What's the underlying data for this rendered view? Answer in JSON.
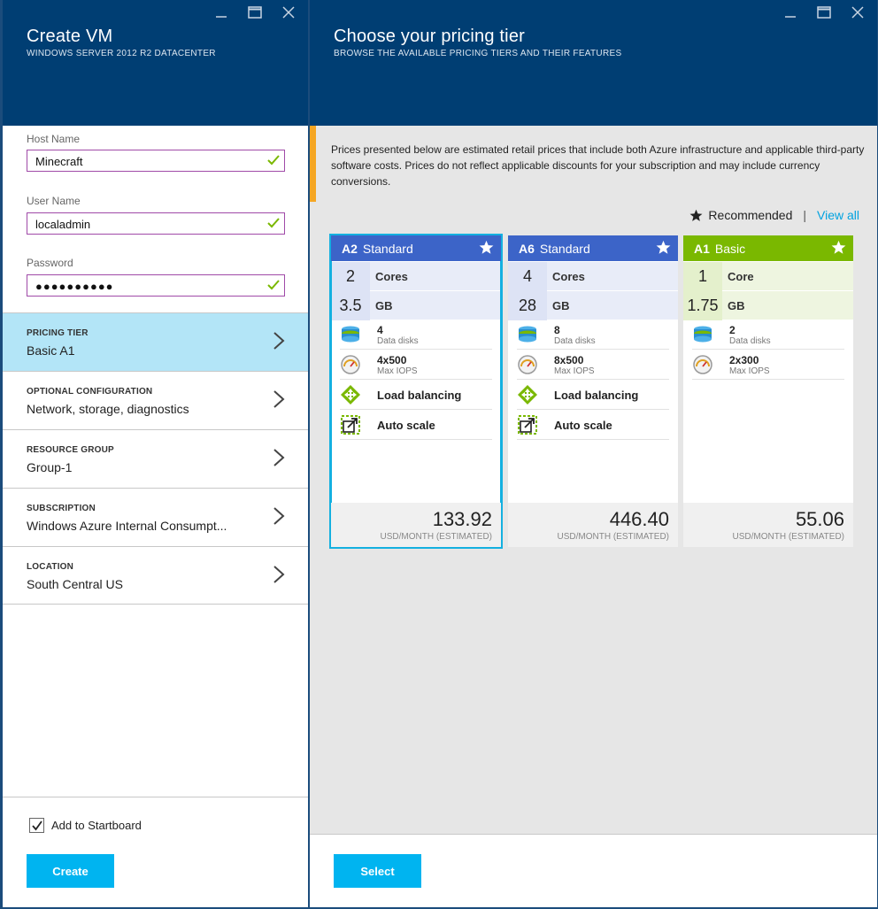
{
  "left_blade": {
    "title": "Create VM",
    "subtitle": "WINDOWS SERVER 2012 R2 DATACENTER",
    "fields": [
      {
        "label": "Host Name",
        "value": "Minecraft"
      },
      {
        "label": "User Name",
        "value": "localadmin"
      },
      {
        "label": "Password",
        "value": "●●●●●●●●●●"
      }
    ],
    "nav": [
      {
        "label": "PRICING TIER",
        "value": "Basic A1"
      },
      {
        "label": "OPTIONAL CONFIGURATION",
        "value": "Network, storage, diagnostics"
      },
      {
        "label": "RESOURCE GROUP",
        "value": "Group-1"
      },
      {
        "label": "SUBSCRIPTION",
        "value": "Windows Azure Internal Consumpt..."
      },
      {
        "label": "LOCATION",
        "value": "South Central US"
      }
    ],
    "startboard_label": "Add to Startboard",
    "startboard_checked": true,
    "create_label": "Create"
  },
  "right_blade": {
    "title": "Choose your pricing tier",
    "subtitle": "BROWSE THE AVAILABLE PRICING TIERS AND THEIR FEATURES",
    "notice": "Prices presented below are estimated retail prices that include both Azure infrastructure and applicable third-party software costs. Prices do not reflect applicable discounts for your subscription and may include currency conversions.",
    "recommended_label": "Recommended",
    "separator": "|",
    "view_all_label": "View all",
    "select_label": "Select",
    "price_unit": "USD/MONTH (ESTIMATED)",
    "cards": [
      {
        "tier": "A2",
        "edition": "Standard",
        "header_color": "#3c64c8",
        "spec_bg": "#e8ecf8",
        "num_bg": "#dde3f5",
        "cores": "2",
        "cores_unit": "Cores",
        "memory": "3.5",
        "memory_unit": "GB",
        "disks": "4",
        "disks_label": "Data disks",
        "iops": "4x500",
        "iops_label": "Max IOPS",
        "load_balancing": "Load balancing",
        "auto_scale": "Auto scale",
        "price": "133.92",
        "selected": true
      },
      {
        "tier": "A6",
        "edition": "Standard",
        "header_color": "#3c64c8",
        "spec_bg": "#e8ecf8",
        "num_bg": "#dde3f5",
        "cores": "4",
        "cores_unit": "Cores",
        "memory": "28",
        "memory_unit": "GB",
        "disks": "8",
        "disks_label": "Data disks",
        "iops": "8x500",
        "iops_label": "Max IOPS",
        "load_balancing": "Load balancing",
        "auto_scale": "Auto scale",
        "price": "446.40",
        "selected": false
      },
      {
        "tier": "A1",
        "edition": "Basic",
        "header_color": "#7ab800",
        "spec_bg": "#eef5e0",
        "num_bg": "#e4f0cc",
        "cores": "1",
        "cores_unit": "Core",
        "memory": "1.75",
        "memory_unit": "GB",
        "disks": "2",
        "disks_label": "Data disks",
        "iops": "2x300",
        "iops_label": "Max IOPS",
        "price": "55.06",
        "selected": false
      }
    ]
  },
  "colors": {
    "header_bg": "#003e73",
    "accent_blue": "#00b4f0",
    "selected_border": "#14b0e0",
    "valid_check": "#7ab800",
    "notice_bar": "#f5a623"
  }
}
